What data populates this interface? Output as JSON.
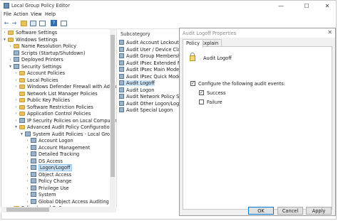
{
  "window": {
    "title": "Local Group Policy Editor"
  },
  "menu": [
    "File",
    "Action",
    "View",
    "Help"
  ],
  "tree": [
    {
      "label": "Software Settings",
      "level": 1,
      "icon": "folder-icon",
      "expander": ">"
    },
    {
      "label": "Windows Settings",
      "level": 1,
      "icon": "folder-icon",
      "expander": "v"
    },
    {
      "label": "Name Resolution Policy",
      "level": 2,
      "icon": "folder-icon",
      "expander": ">"
    },
    {
      "label": "Scripts (Startup/Shutdown)",
      "level": 2,
      "icon": "doc-icon",
      "expander": ""
    },
    {
      "label": "Deployed Printers",
      "level": 2,
      "icon": "doc-icon",
      "expander": ">"
    },
    {
      "label": "Security Settings",
      "level": 2,
      "icon": "doc-icon",
      "expander": "v"
    },
    {
      "label": "Account Policies",
      "level": 3,
      "icon": "folder-icon",
      "expander": ">"
    },
    {
      "label": "Local Policies",
      "level": 3,
      "icon": "folder-icon",
      "expander": ">"
    },
    {
      "label": "Windows Defender Firewall with Advan",
      "level": 3,
      "icon": "folder-icon",
      "expander": ">"
    },
    {
      "label": "Network List Manager Policies",
      "level": 3,
      "icon": "folder-icon",
      "expander": ""
    },
    {
      "label": "Public Key Policies",
      "level": 3,
      "icon": "folder-icon",
      "expander": ">"
    },
    {
      "label": "Software Restriction Policies",
      "level": 3,
      "icon": "folder-icon",
      "expander": ">"
    },
    {
      "label": "Application Control Policies",
      "level": 3,
      "icon": "folder-icon",
      "expander": ">"
    },
    {
      "label": "IP Security Policies on Local Computer",
      "level": 3,
      "icon": "doc-icon",
      "expander": ">"
    },
    {
      "label": "Advanced Audit Policy Configuration",
      "level": 3,
      "icon": "folder-icon",
      "expander": "v"
    },
    {
      "label": "System Audit Policies - Local Group",
      "level": 4,
      "icon": "doc-icon",
      "expander": "v"
    },
    {
      "label": "Account Logon",
      "level": 5,
      "icon": "doc-icon",
      "expander": ">"
    },
    {
      "label": "Account Management",
      "level": 5,
      "icon": "doc-icon",
      "expander": ">"
    },
    {
      "label": "Detailed Tracking",
      "level": 5,
      "icon": "doc-icon",
      "expander": ">"
    },
    {
      "label": "DS Access",
      "level": 5,
      "icon": "doc-icon",
      "expander": ">"
    },
    {
      "label": "Logon/Logoff",
      "level": 5,
      "icon": "doc-icon",
      "expander": ">",
      "selected": true
    },
    {
      "label": "Object Access",
      "level": 5,
      "icon": "doc-icon",
      "expander": ">"
    },
    {
      "label": "Policy Change",
      "level": 5,
      "icon": "doc-icon",
      "expander": ">"
    },
    {
      "label": "Privilege Use",
      "level": 5,
      "icon": "doc-icon",
      "expander": ">"
    },
    {
      "label": "System",
      "level": 5,
      "icon": "doc-icon",
      "expander": ">"
    },
    {
      "label": "Global Object Access Auditing",
      "level": 5,
      "icon": "doc-icon",
      "expander": ">"
    },
    {
      "label": "Policy-based QoS",
      "level": 2,
      "icon": "folder-icon",
      "expander": ">"
    }
  ],
  "subcategory": {
    "header": "Subcategory",
    "items": [
      "Audit Account Lockout",
      "Audit User / Device Claims",
      "Audit Group Membership",
      "Audit IPsec Extended Mode",
      "Audit IPsec Main Mode",
      "Audit IPsec Quick Mode",
      "Audit Logoff",
      "Audit Logon",
      "Audit Network Policy Server",
      "Audit Other Logon/Logoff Eve",
      "Audit Special Logon"
    ],
    "selected_index": 6
  },
  "dialog": {
    "title": "Audit Logoff Properties",
    "tabs": [
      "Policy",
      "Explain"
    ],
    "policy_name": "Audit Logoff",
    "configure_label": "Configure the following audit events:",
    "configure_checked": true,
    "success_label": "Success",
    "success_checked": true,
    "failure_label": "Failure",
    "failure_checked": false,
    "ok_label": "OK",
    "cancel_label": "Cancel",
    "apply_label": "Apply"
  }
}
